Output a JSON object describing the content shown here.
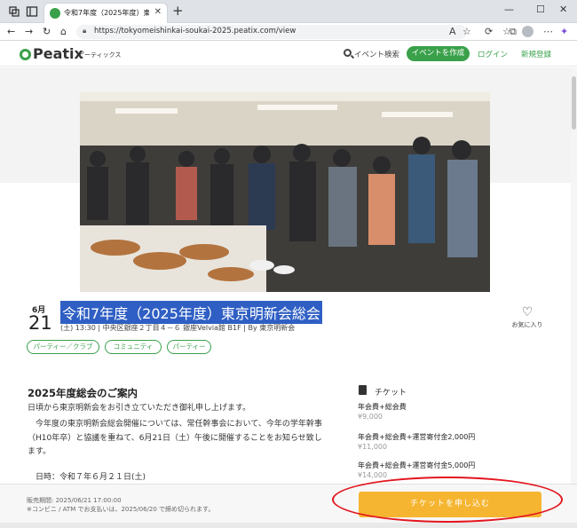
{
  "browser": {
    "tab_title": "令和7年度（2025年度）東京明新",
    "tab_close": "✕",
    "new_tab": "+",
    "url": "https://tokyomeishinkai-soukai-2025.peatix.com/view",
    "window_controls": {
      "minimize": "—",
      "maximize": "☐",
      "close": "✕"
    }
  },
  "site_header": {
    "logo_text": "Peatix",
    "logo_sub": "ピーティックス",
    "search_label": "イベント検索",
    "create_button": "イベントを作成",
    "login_link": "ログイン",
    "signup_link": "新規登録"
  },
  "event": {
    "month": "6月",
    "day": "21",
    "title": "令和7年度（2025年度）東京明新会総会",
    "meta": "(土) 13:30 | 中央区銀座２丁目４－６ 銀座Velvia館 B1F | By 東京明新会",
    "favorite_label": "お気に入り",
    "tags": [
      "パーティー／クラブ",
      "コミュニティ",
      "パーティー"
    ]
  },
  "description": {
    "heading": "2025年度総会のご案内",
    "lines": [
      "日頃から東京明新会をお引き立ていただき御礼申し上げます。",
      "　今年度の東京明新会総会開催については、常任幹事会において、今年の学年幹事",
      "（H10年卒）と協議を重ねて、6月21日（土）午後に開催することをお知らせ致し",
      "ます。",
      "　日時：令和７年６月２１日(土)"
    ]
  },
  "tickets": {
    "heading": "チケット",
    "items": [
      {
        "name": "年会費+総会費",
        "price": "¥9,000"
      },
      {
        "name": "年会費+総会費+運営寄付金2,000円",
        "price": "¥11,000"
      },
      {
        "name": "年会費+総会費+運営寄付金5,000円",
        "price": "¥14,000"
      }
    ]
  },
  "bottom_bar": {
    "sale_period": "販売期間: 2025/06/21 17:00:00",
    "sale_note": "※コンビニ / ATM でお支払いは、2025/06/20 で締め切られます。",
    "buy_button": "チケットを申し込む"
  },
  "colors": {
    "brand_green": "#3aa14a",
    "buy_button": "#f6b531",
    "highlight": "#e3161f"
  }
}
